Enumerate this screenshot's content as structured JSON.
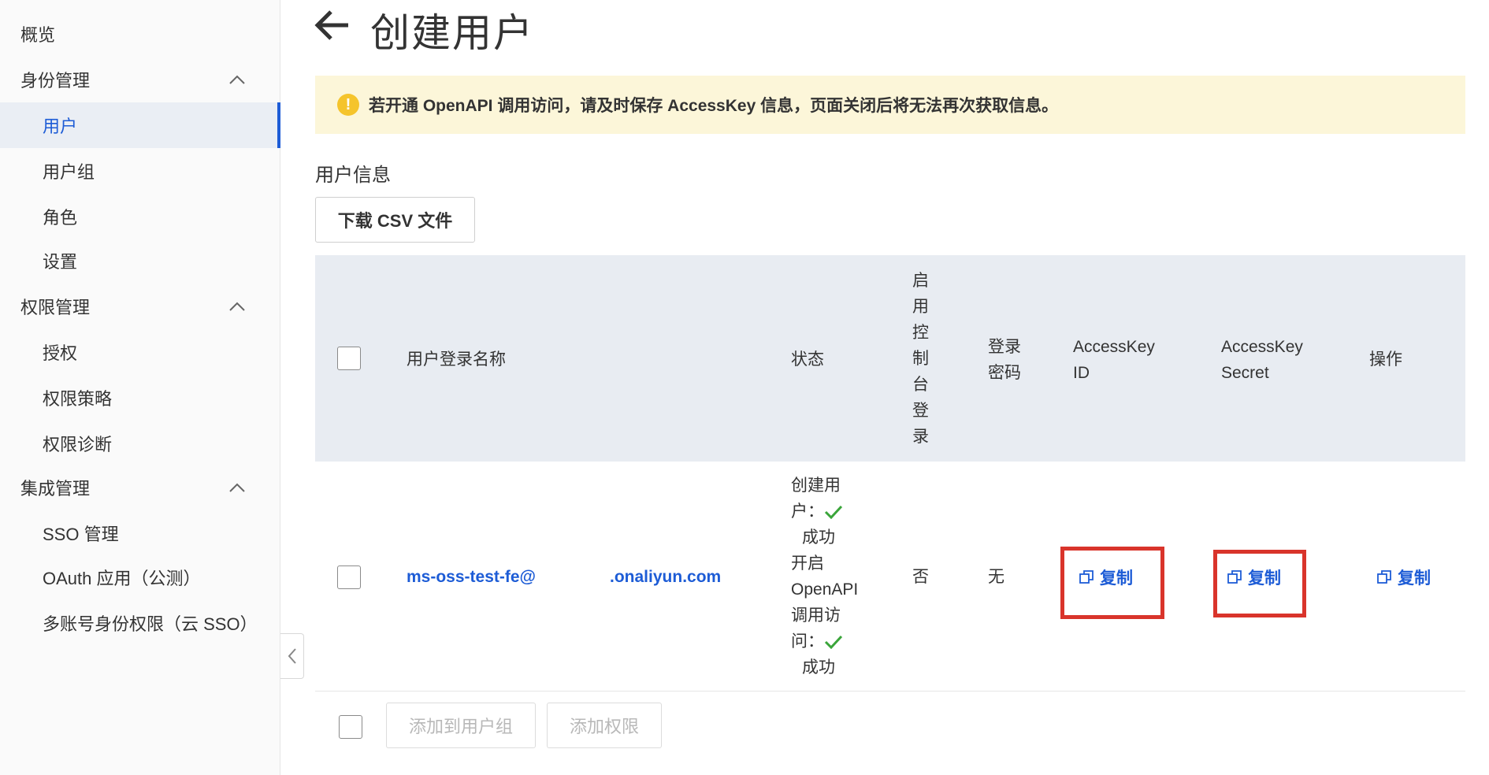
{
  "sidebar": {
    "items": [
      {
        "label": "概览"
      },
      {
        "label": "身份管理"
      },
      {
        "label": "用户"
      },
      {
        "label": "用户组"
      },
      {
        "label": "角色"
      },
      {
        "label": "设置"
      },
      {
        "label": "权限管理"
      },
      {
        "label": "授权"
      },
      {
        "label": "权限策略"
      },
      {
        "label": "权限诊断"
      },
      {
        "label": "集成管理"
      },
      {
        "label": "SSO 管理"
      },
      {
        "label": "OAuth 应用（公测）"
      },
      {
        "label": "多账号身份权限（云 SSO）"
      }
    ],
    "active": "用户"
  },
  "header": {
    "title": "创建用户"
  },
  "alert": {
    "text": "若开通 OpenAPI 调用访问，请及时保存 AccessKey 信息，页面关闭后将无法再次获取信息。",
    "color": "#fcf6d9"
  },
  "user_info": {
    "title": "用户信息",
    "download_label": "下载 CSV 文件"
  },
  "table": {
    "headers": {
      "login_name": "用户登录名称",
      "status": "状态",
      "console_login": [
        "启",
        "用",
        "控",
        "制",
        "台",
        "登",
        "录"
      ],
      "password": [
        "登录",
        "密码"
      ],
      "ak_id": [
        "AccessKey",
        "ID"
      ],
      "ak_secret": [
        "AccessKey",
        "Secret"
      ],
      "actions": "操作"
    },
    "rows": [
      {
        "login_name_part1": "ms-oss-test-fe@",
        "login_name_part2": ".onaliyun.com",
        "status_lines": [
          "创建用",
          "户：",
          "成功",
          "开启",
          "OpenAPI",
          "调用访",
          "问：",
          "成功"
        ],
        "console_login": "否",
        "password": "无",
        "ak_id_action": "复制",
        "ak_secret_action": "复制",
        "op_action": "复制"
      }
    ]
  },
  "footer": {
    "add_to_group": "添加到用户组",
    "add_permission": "添加权限"
  },
  "colors": {
    "accent": "#1d5cd6",
    "highlight": "#d9342b",
    "success": "#3aa53a"
  }
}
